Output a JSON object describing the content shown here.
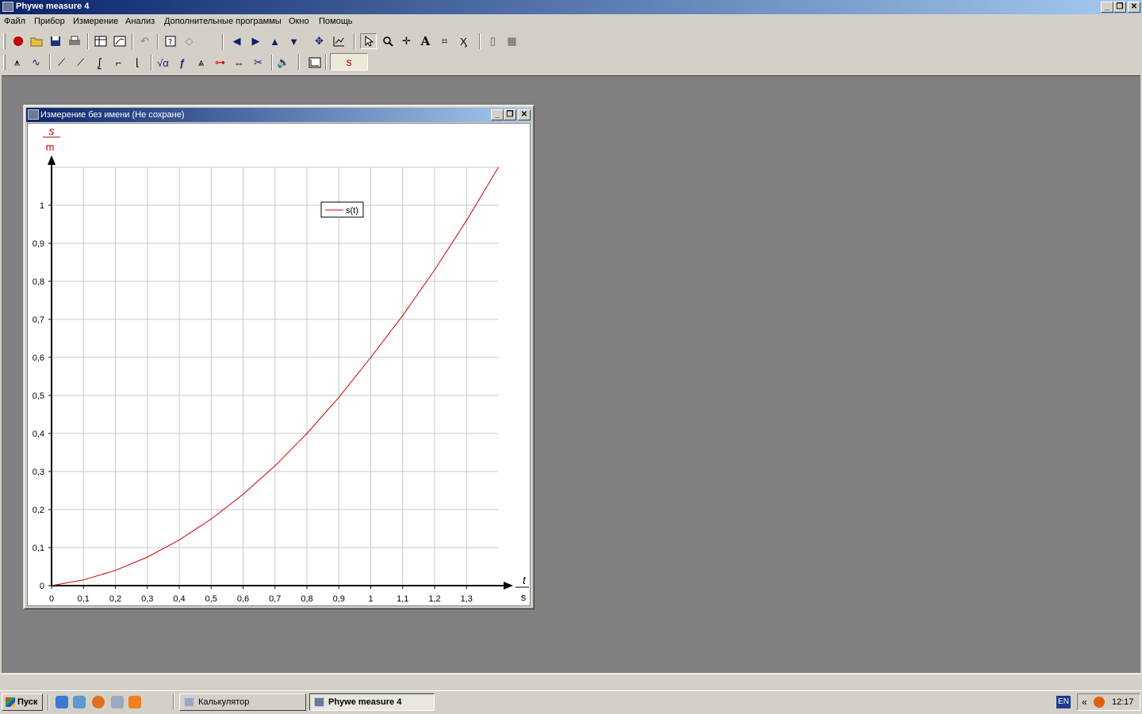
{
  "app": {
    "title": "Phywe measure 4",
    "caption_buttons": {
      "minimize": "_",
      "restore": "❐",
      "close": "✕"
    }
  },
  "menu": {
    "items": [
      "Файл",
      "Прибор",
      "Измерение",
      "Анализ",
      "Дополнительные программы",
      "Окно",
      "Помощь"
    ]
  },
  "toolbar": {
    "s_field": "s"
  },
  "child_window": {
    "title": "Измерение без имени (Не сохране)"
  },
  "chart_data": {
    "type": "line",
    "y_axis": {
      "symbol": "s",
      "unit": "m",
      "ylim": [
        0,
        1.1
      ],
      "ticks": [
        "0",
        "0,1",
        "0,2",
        "0,3",
        "0,4",
        "0,5",
        "0,6",
        "0,7",
        "0,8",
        "0,9",
        "1"
      ]
    },
    "x_axis": {
      "symbol": "t",
      "unit": "s",
      "xlim": [
        0,
        1.4
      ],
      "ticks": [
        "0",
        "0,1",
        "0,2",
        "0,3",
        "0,4",
        "0,5",
        "0,6",
        "0,7",
        "0,8",
        "0,9",
        "1",
        "1,1",
        "1,2",
        "1,3"
      ]
    },
    "grid": true,
    "legend": {
      "position": "top-right",
      "entries": [
        "s(t)"
      ]
    },
    "series": [
      {
        "name": "s(t)",
        "color": "#cc0000",
        "x": [
          0,
          0.1,
          0.2,
          0.3,
          0.4,
          0.5,
          0.6,
          0.7,
          0.8,
          0.9,
          1.0,
          1.1,
          1.2,
          1.3,
          1.4
        ],
        "y": [
          0,
          0.015,
          0.04,
          0.075,
          0.12,
          0.175,
          0.24,
          0.315,
          0.4,
          0.495,
          0.6,
          0.71,
          0.83,
          0.96,
          1.1
        ]
      }
    ]
  },
  "taskbar": {
    "start_label": "Пуск",
    "tasks": [
      "Калькулятор",
      "Phywe measure 4"
    ],
    "language": "EN",
    "tray_arrow": "«",
    "clock": "12:17"
  }
}
